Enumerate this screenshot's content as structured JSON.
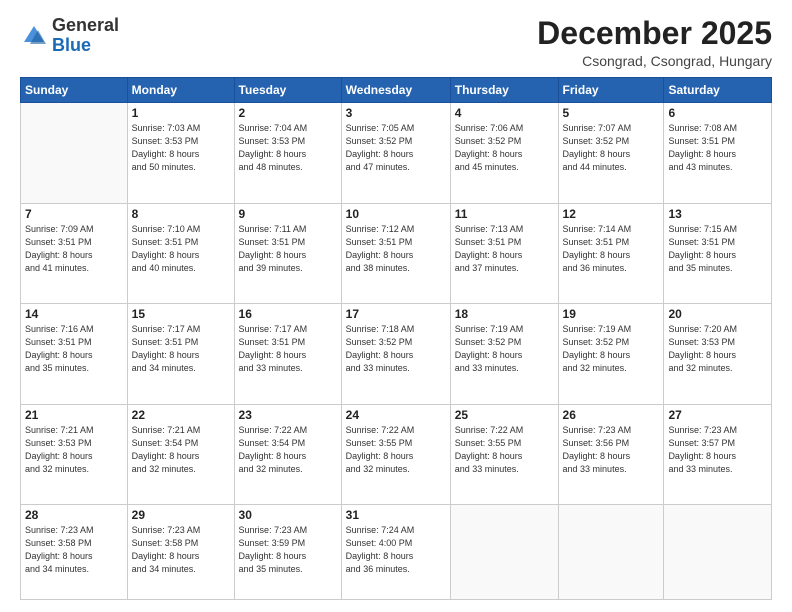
{
  "logo": {
    "general": "General",
    "blue": "Blue"
  },
  "header": {
    "month_title": "December 2025",
    "location": "Csongrad, Csongrad, Hungary"
  },
  "weekdays": [
    "Sunday",
    "Monday",
    "Tuesday",
    "Wednesday",
    "Thursday",
    "Friday",
    "Saturday"
  ],
  "weeks": [
    [
      {
        "day": "",
        "info": ""
      },
      {
        "day": "1",
        "info": "Sunrise: 7:03 AM\nSunset: 3:53 PM\nDaylight: 8 hours\nand 50 minutes."
      },
      {
        "day": "2",
        "info": "Sunrise: 7:04 AM\nSunset: 3:53 PM\nDaylight: 8 hours\nand 48 minutes."
      },
      {
        "day": "3",
        "info": "Sunrise: 7:05 AM\nSunset: 3:52 PM\nDaylight: 8 hours\nand 47 minutes."
      },
      {
        "day": "4",
        "info": "Sunrise: 7:06 AM\nSunset: 3:52 PM\nDaylight: 8 hours\nand 45 minutes."
      },
      {
        "day": "5",
        "info": "Sunrise: 7:07 AM\nSunset: 3:52 PM\nDaylight: 8 hours\nand 44 minutes."
      },
      {
        "day": "6",
        "info": "Sunrise: 7:08 AM\nSunset: 3:51 PM\nDaylight: 8 hours\nand 43 minutes."
      }
    ],
    [
      {
        "day": "7",
        "info": "Sunrise: 7:09 AM\nSunset: 3:51 PM\nDaylight: 8 hours\nand 41 minutes."
      },
      {
        "day": "8",
        "info": "Sunrise: 7:10 AM\nSunset: 3:51 PM\nDaylight: 8 hours\nand 40 minutes."
      },
      {
        "day": "9",
        "info": "Sunrise: 7:11 AM\nSunset: 3:51 PM\nDaylight: 8 hours\nand 39 minutes."
      },
      {
        "day": "10",
        "info": "Sunrise: 7:12 AM\nSunset: 3:51 PM\nDaylight: 8 hours\nand 38 minutes."
      },
      {
        "day": "11",
        "info": "Sunrise: 7:13 AM\nSunset: 3:51 PM\nDaylight: 8 hours\nand 37 minutes."
      },
      {
        "day": "12",
        "info": "Sunrise: 7:14 AM\nSunset: 3:51 PM\nDaylight: 8 hours\nand 36 minutes."
      },
      {
        "day": "13",
        "info": "Sunrise: 7:15 AM\nSunset: 3:51 PM\nDaylight: 8 hours\nand 35 minutes."
      }
    ],
    [
      {
        "day": "14",
        "info": "Sunrise: 7:16 AM\nSunset: 3:51 PM\nDaylight: 8 hours\nand 35 minutes."
      },
      {
        "day": "15",
        "info": "Sunrise: 7:17 AM\nSunset: 3:51 PM\nDaylight: 8 hours\nand 34 minutes."
      },
      {
        "day": "16",
        "info": "Sunrise: 7:17 AM\nSunset: 3:51 PM\nDaylight: 8 hours\nand 33 minutes."
      },
      {
        "day": "17",
        "info": "Sunrise: 7:18 AM\nSunset: 3:52 PM\nDaylight: 8 hours\nand 33 minutes."
      },
      {
        "day": "18",
        "info": "Sunrise: 7:19 AM\nSunset: 3:52 PM\nDaylight: 8 hours\nand 33 minutes."
      },
      {
        "day": "19",
        "info": "Sunrise: 7:19 AM\nSunset: 3:52 PM\nDaylight: 8 hours\nand 32 minutes."
      },
      {
        "day": "20",
        "info": "Sunrise: 7:20 AM\nSunset: 3:53 PM\nDaylight: 8 hours\nand 32 minutes."
      }
    ],
    [
      {
        "day": "21",
        "info": "Sunrise: 7:21 AM\nSunset: 3:53 PM\nDaylight: 8 hours\nand 32 minutes."
      },
      {
        "day": "22",
        "info": "Sunrise: 7:21 AM\nSunset: 3:54 PM\nDaylight: 8 hours\nand 32 minutes."
      },
      {
        "day": "23",
        "info": "Sunrise: 7:22 AM\nSunset: 3:54 PM\nDaylight: 8 hours\nand 32 minutes."
      },
      {
        "day": "24",
        "info": "Sunrise: 7:22 AM\nSunset: 3:55 PM\nDaylight: 8 hours\nand 32 minutes."
      },
      {
        "day": "25",
        "info": "Sunrise: 7:22 AM\nSunset: 3:55 PM\nDaylight: 8 hours\nand 33 minutes."
      },
      {
        "day": "26",
        "info": "Sunrise: 7:23 AM\nSunset: 3:56 PM\nDaylight: 8 hours\nand 33 minutes."
      },
      {
        "day": "27",
        "info": "Sunrise: 7:23 AM\nSunset: 3:57 PM\nDaylight: 8 hours\nand 33 minutes."
      }
    ],
    [
      {
        "day": "28",
        "info": "Sunrise: 7:23 AM\nSunset: 3:58 PM\nDaylight: 8 hours\nand 34 minutes."
      },
      {
        "day": "29",
        "info": "Sunrise: 7:23 AM\nSunset: 3:58 PM\nDaylight: 8 hours\nand 34 minutes."
      },
      {
        "day": "30",
        "info": "Sunrise: 7:23 AM\nSunset: 3:59 PM\nDaylight: 8 hours\nand 35 minutes."
      },
      {
        "day": "31",
        "info": "Sunrise: 7:24 AM\nSunset: 4:00 PM\nDaylight: 8 hours\nand 36 minutes."
      },
      {
        "day": "",
        "info": ""
      },
      {
        "day": "",
        "info": ""
      },
      {
        "day": "",
        "info": ""
      }
    ]
  ]
}
